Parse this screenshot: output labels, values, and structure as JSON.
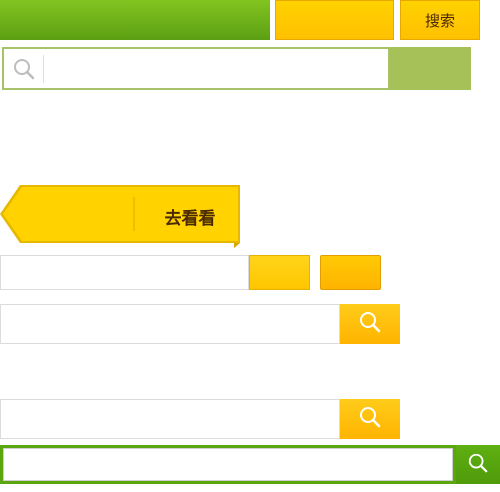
{
  "top_bar": {
    "search_button_label": "搜索"
  },
  "tag": {
    "label": "去看看"
  },
  "icons": {
    "search": "search-icon"
  },
  "colors": {
    "green": "#5c9f13",
    "yellow": "#ffc000",
    "light_green": "#a7c159"
  }
}
